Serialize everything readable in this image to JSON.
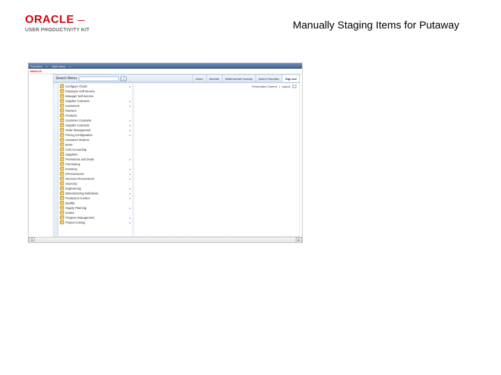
{
  "page": {
    "title": "Manually Staging Items for Putaway"
  },
  "brand": {
    "name": "ORACLE",
    "sub": "USER PRODUCTIVITY KIT"
  },
  "topbar": {
    "items": [
      "Favorites",
      "Main Menu"
    ]
  },
  "sublogo": "ORACLE",
  "menubar": {
    "search_label": "Search Menu:",
    "search_value": "",
    "tabs": [
      {
        "label": "Home"
      },
      {
        "label": "Worklist"
      },
      {
        "label": "MultiChannel Console"
      },
      {
        "label": "Add to Favorites"
      },
      {
        "label": "Sign out",
        "active": true
      }
    ]
  },
  "nav": {
    "items": [
      {
        "label": "Configure Chunk",
        "expandable": true
      },
      {
        "label": "Employee Self-Service",
        "expandable": false
      },
      {
        "label": "Manager Self-Service",
        "expandable": false
      },
      {
        "label": "Supplier Contracts",
        "expandable": true
      },
      {
        "label": "Customers",
        "expandable": true
      },
      {
        "label": "Partners",
        "expandable": false
      },
      {
        "label": "Products",
        "expandable": false
      },
      {
        "label": "Customer Contracts",
        "expandable": true
      },
      {
        "label": "Supplier Contracts",
        "expandable": true
      },
      {
        "label": "Order Management",
        "expandable": true
      },
      {
        "label": "Pricing Configuration",
        "expandable": true
      },
      {
        "label": "Customer Returns",
        "expandable": false
      },
      {
        "label": "Items",
        "expandable": false
      },
      {
        "label": "Cost Accounting",
        "expandable": false
      },
      {
        "label": "Suppliers",
        "expandable": false
      },
      {
        "label": "Promotions and Deals",
        "expandable": true
      },
      {
        "label": "Purchasing",
        "expandable": false
      },
      {
        "label": "Inventory",
        "expandable": true
      },
      {
        "label": "eProcurement",
        "expandable": true
      },
      {
        "label": "Services Procurement",
        "expandable": true
      },
      {
        "label": "Sourcing",
        "expandable": false
      },
      {
        "label": "Engineering",
        "expandable": true
      },
      {
        "label": "Manufacturing Definitions",
        "expandable": true
      },
      {
        "label": "Production Control",
        "expandable": true
      },
      {
        "label": "Quality",
        "expandable": false
      },
      {
        "label": "Supply Planning",
        "expandable": true
      },
      {
        "label": "Grants",
        "expandable": false
      },
      {
        "label": "Program Management",
        "expandable": true
      },
      {
        "label": "Project Costing",
        "expandable": true
      }
    ]
  },
  "content": {
    "personalize_label": "Personalize Content",
    "layout_label": "Layout"
  }
}
